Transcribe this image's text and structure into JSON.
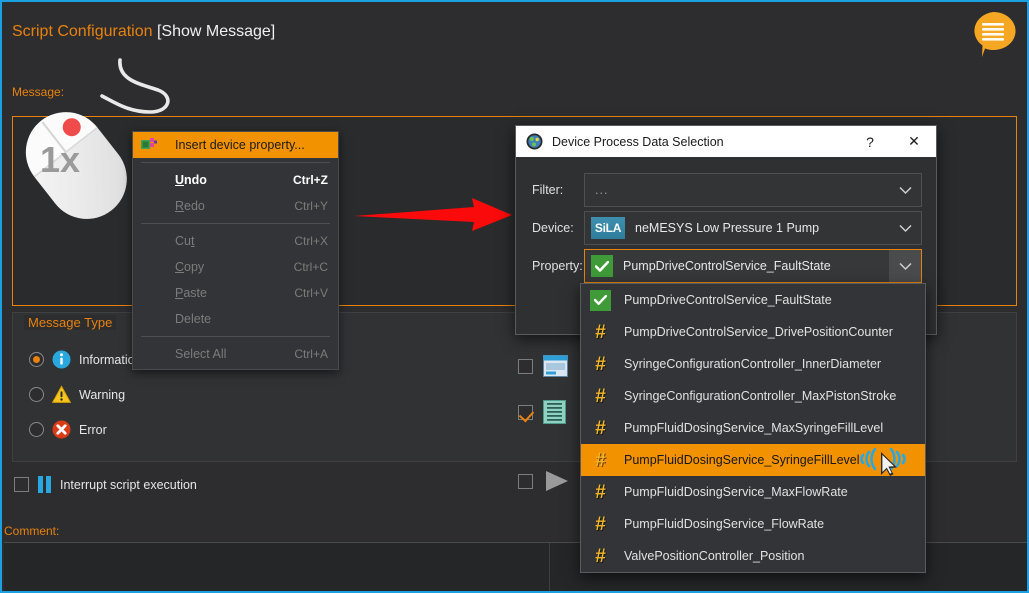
{
  "window": {
    "accent_color": "#e8820c",
    "border_color": "#1ba1e2",
    "background": "#2d2d30"
  },
  "panel": {
    "title_accent": "Script Configuration",
    "title_rest": "[Show Message]",
    "message_label": "Message:",
    "comment_label": "Comment:",
    "message_value": "",
    "comment_value": ""
  },
  "message_type": {
    "group_title": "Message Type",
    "options": [
      {
        "label": "Information",
        "icon": "info-icon",
        "selected": true
      },
      {
        "label": "Warning",
        "icon": "warning-icon",
        "selected": false
      },
      {
        "label": "Error",
        "icon": "error-icon",
        "selected": false
      }
    ]
  },
  "interrupt": {
    "label": "Interrupt script execution",
    "icon": "pause-icon",
    "checked": false
  },
  "side_options": [
    {
      "icon": "window-icon",
      "checked": false
    },
    {
      "icon": "list-icon",
      "checked": true
    },
    {
      "icon": "play-icon",
      "checked": false
    }
  ],
  "bubble_button": {
    "icon": "speech-bubble-icon",
    "color": "#f5a623"
  },
  "mouse_hint": {
    "label": "1x",
    "icon": "mouse-right-click-icon"
  },
  "arrow": {
    "icon": "arrow-right-icon",
    "color": "#fa0a0a"
  },
  "context_menu": {
    "items": [
      {
        "label": "Insert device property...",
        "shortcut": "",
        "state": "highlight",
        "icon": "device-property-icon"
      },
      {
        "label": "Undo",
        "shortcut": "Ctrl+Z",
        "state": "enabled",
        "mnemonic": "U"
      },
      {
        "label": "Redo",
        "shortcut": "Ctrl+Y",
        "state": "disabled",
        "mnemonic": "R"
      },
      {
        "label": "Cut",
        "shortcut": "Ctrl+X",
        "state": "disabled",
        "mnemonic": "t"
      },
      {
        "label": "Copy",
        "shortcut": "Ctrl+C",
        "state": "disabled",
        "mnemonic": "C"
      },
      {
        "label": "Paste",
        "shortcut": "Ctrl+V",
        "state": "disabled",
        "mnemonic": "P"
      },
      {
        "label": "Delete",
        "shortcut": "",
        "state": "disabled"
      },
      {
        "label": "Select All",
        "shortcut": "Ctrl+A",
        "state": "disabled"
      }
    ]
  },
  "dialog": {
    "title": "Device Process Data Selection",
    "title_icon": "app-globe-icon",
    "help_label": "?",
    "close_label": "✕",
    "rows": {
      "filter_label": "Filter:",
      "filter_value": "...",
      "device_label": "Device:",
      "device_value": "neMESYS Low Pressure 1 Pump",
      "device_badge": "SiLA",
      "property_label": "Property:",
      "property_value": "PumpDriveControlService_FaultState"
    }
  },
  "dropdown": {
    "items": [
      {
        "label": "PumpDriveControlService_FaultState",
        "icon": "bool-check-icon",
        "selected": false
      },
      {
        "label": "PumpDriveControlService_DrivePositionCounter",
        "icon": "number-hash-icon",
        "selected": false
      },
      {
        "label": "SyringeConfigurationController_InnerDiameter",
        "icon": "number-hash-icon",
        "selected": false
      },
      {
        "label": "SyringeConfigurationController_MaxPistonStroke",
        "icon": "number-hash-icon",
        "selected": false
      },
      {
        "label": "PumpFluidDosingService_MaxSyringeFillLevel",
        "icon": "number-hash-icon",
        "selected": false
      },
      {
        "label": "PumpFluidDosingService_SyringeFillLevel",
        "icon": "number-hash-icon",
        "selected": true
      },
      {
        "label": "PumpFluidDosingService_MaxFlowRate",
        "icon": "number-hash-icon",
        "selected": false
      },
      {
        "label": "PumpFluidDosingService_FlowRate",
        "icon": "number-hash-icon",
        "selected": false
      },
      {
        "label": "ValvePositionController_Position",
        "icon": "number-hash-icon",
        "selected": false
      }
    ],
    "cursor_icon": "mouse-cursor-click-icon"
  }
}
